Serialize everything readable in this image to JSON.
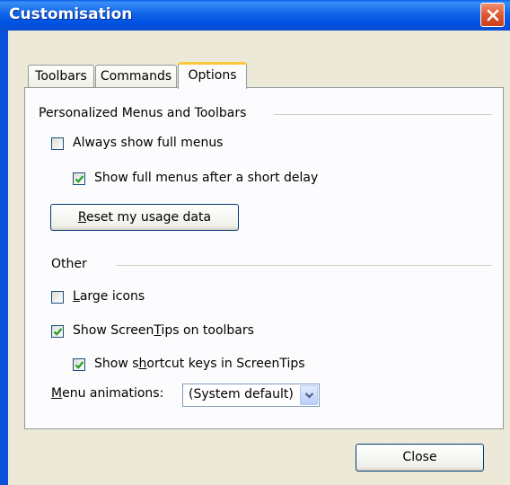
{
  "window": {
    "title": "Customisation"
  },
  "tabs": [
    {
      "label": "Toolbars"
    },
    {
      "label": "Commands"
    },
    {
      "label": "Options"
    }
  ],
  "personalized": {
    "heading": "Personalized Menus and Toolbars",
    "always_show_full": {
      "label": "Always show full menus",
      "checked": false
    },
    "show_after_delay": {
      "label": "Show full menus after a short delay",
      "checked": true
    },
    "reset_button": {
      "accel": "R",
      "rest": "eset my usage data"
    }
  },
  "other": {
    "heading": "Other",
    "large_icons": {
      "accel": "L",
      "rest": "arge icons",
      "checked": false
    },
    "screentips": {
      "pre": "Show Screen",
      "accel": "T",
      "post": "ips on toolbars",
      "checked": true
    },
    "shortcut_keys": {
      "pre": "Show s",
      "accel": "h",
      "post": "ortcut keys in ScreenTips",
      "checked": true
    },
    "menu_animations": {
      "accel": "M",
      "rest": "enu animations:",
      "value": "(System default)"
    }
  },
  "footer": {
    "close_label": "Close"
  },
  "colors": {
    "titlebar": "#0054E3",
    "dialog_bg": "#ECE9D8",
    "check": "#21A121",
    "tab_highlight": "#FFC83C"
  }
}
